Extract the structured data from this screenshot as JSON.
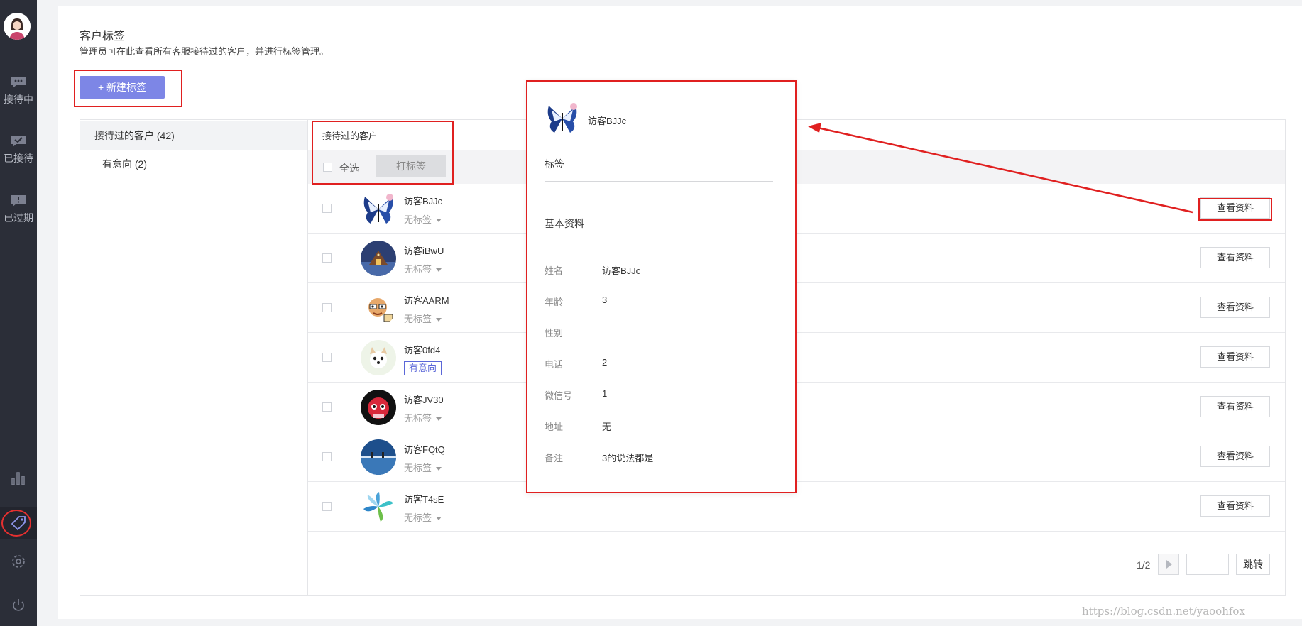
{
  "page": {
    "title": "客户标签",
    "description": "管理员可在此查看所有客服接待过的客户，并进行标签管理。",
    "new_tag_button": "+ 新建标签"
  },
  "nav": {
    "items": [
      {
        "label": "接待中",
        "icon": "chat-icon"
      },
      {
        "label": "已接待",
        "icon": "check-chat-icon"
      },
      {
        "label": "已过期",
        "icon": "exclamation-chat-icon"
      }
    ],
    "bottom_icons": [
      "bar-chart-icon",
      "tag-icon",
      "gear-icon",
      "power-icon"
    ]
  },
  "sidebar": {
    "items": [
      {
        "label": "接待过的客户 (42)",
        "active": true
      },
      {
        "label": "有意向 (2)",
        "active": false
      }
    ]
  },
  "list": {
    "title": "接待过的客户",
    "select_all": "全选",
    "tag_button": "打标签",
    "view_button": "查看资料",
    "rows": [
      {
        "name": "访客BJJc",
        "tag": "无标签",
        "chip": false
      },
      {
        "name": "访客iBwU",
        "tag": "无标签",
        "chip": false
      },
      {
        "name": "访客AARM",
        "tag": "无标签",
        "chip": false
      },
      {
        "name": "访客0fd4",
        "tag": "有意向",
        "chip": true
      },
      {
        "name": "访客JV30",
        "tag": "无标签",
        "chip": false
      },
      {
        "name": "访客FQtQ",
        "tag": "无标签",
        "chip": false
      },
      {
        "name": "访客T4sE",
        "tag": "无标签",
        "chip": false
      }
    ]
  },
  "pager": {
    "page_text": "1/2",
    "jump_label": "跳转"
  },
  "popup": {
    "name": "访客BJJc",
    "tags_title": "标签",
    "basic_title": "基本资料",
    "fields": [
      {
        "key": "姓名",
        "value": "访客BJJc"
      },
      {
        "key": "年龄",
        "value": "3"
      },
      {
        "key": "性别",
        "value": ""
      },
      {
        "key": "电话",
        "value": "2"
      },
      {
        "key": "微信号",
        "value": "1"
      },
      {
        "key": "地址",
        "value": "无"
      },
      {
        "key": "备注",
        "value": "3的说法都是"
      }
    ]
  },
  "watermark": "https://blog.csdn.net/yaoohfox",
  "colors": {
    "nav_bg": "#2b2e38",
    "accent": "#7d86e6",
    "annotation_red": "#e02020",
    "chip_blue": "#5b67d8"
  }
}
